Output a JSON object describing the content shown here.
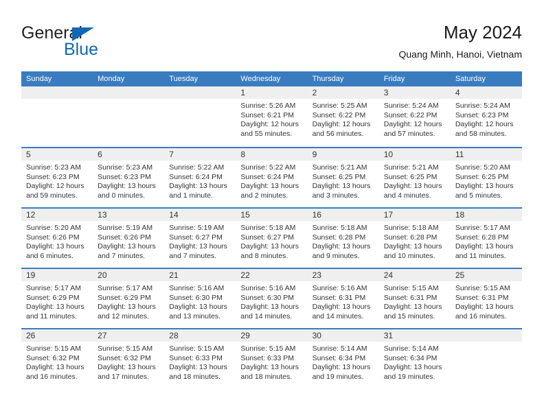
{
  "brand": {
    "name_top": "General",
    "name_bottom": "Blue",
    "accent_color": "#1268b3"
  },
  "header": {
    "title": "May 2024",
    "subtitle": "Quang Minh, Hanoi, Vietnam"
  },
  "theme": {
    "header_bar": "#3a7cc0",
    "day_band": "#efefef",
    "text": "#333333"
  },
  "weekdays": [
    "Sunday",
    "Monday",
    "Tuesday",
    "Wednesday",
    "Thursday",
    "Friday",
    "Saturday"
  ],
  "weeks": [
    [
      {
        "day": "",
        "lines": []
      },
      {
        "day": "",
        "lines": []
      },
      {
        "day": "",
        "lines": []
      },
      {
        "day": "1",
        "lines": [
          "Sunrise: 5:26 AM",
          "Sunset: 6:21 PM",
          "Daylight: 12 hours",
          "and 55 minutes."
        ]
      },
      {
        "day": "2",
        "lines": [
          "Sunrise: 5:25 AM",
          "Sunset: 6:22 PM",
          "Daylight: 12 hours",
          "and 56 minutes."
        ]
      },
      {
        "day": "3",
        "lines": [
          "Sunrise: 5:24 AM",
          "Sunset: 6:22 PM",
          "Daylight: 12 hours",
          "and 57 minutes."
        ]
      },
      {
        "day": "4",
        "lines": [
          "Sunrise: 5:24 AM",
          "Sunset: 6:23 PM",
          "Daylight: 12 hours",
          "and 58 minutes."
        ]
      }
    ],
    [
      {
        "day": "5",
        "lines": [
          "Sunrise: 5:23 AM",
          "Sunset: 6:23 PM",
          "Daylight: 12 hours",
          "and 59 minutes."
        ]
      },
      {
        "day": "6",
        "lines": [
          "Sunrise: 5:23 AM",
          "Sunset: 6:23 PM",
          "Daylight: 13 hours",
          "and 0 minutes."
        ]
      },
      {
        "day": "7",
        "lines": [
          "Sunrise: 5:22 AM",
          "Sunset: 6:24 PM",
          "Daylight: 13 hours",
          "and 1 minute."
        ]
      },
      {
        "day": "8",
        "lines": [
          "Sunrise: 5:22 AM",
          "Sunset: 6:24 PM",
          "Daylight: 13 hours",
          "and 2 minutes."
        ]
      },
      {
        "day": "9",
        "lines": [
          "Sunrise: 5:21 AM",
          "Sunset: 6:25 PM",
          "Daylight: 13 hours",
          "and 3 minutes."
        ]
      },
      {
        "day": "10",
        "lines": [
          "Sunrise: 5:21 AM",
          "Sunset: 6:25 PM",
          "Daylight: 13 hours",
          "and 4 minutes."
        ]
      },
      {
        "day": "11",
        "lines": [
          "Sunrise: 5:20 AM",
          "Sunset: 6:25 PM",
          "Daylight: 13 hours",
          "and 5 minutes."
        ]
      }
    ],
    [
      {
        "day": "12",
        "lines": [
          "Sunrise: 5:20 AM",
          "Sunset: 6:26 PM",
          "Daylight: 13 hours",
          "and 6 minutes."
        ]
      },
      {
        "day": "13",
        "lines": [
          "Sunrise: 5:19 AM",
          "Sunset: 6:26 PM",
          "Daylight: 13 hours",
          "and 7 minutes."
        ]
      },
      {
        "day": "14",
        "lines": [
          "Sunrise: 5:19 AM",
          "Sunset: 6:27 PM",
          "Daylight: 13 hours",
          "and 7 minutes."
        ]
      },
      {
        "day": "15",
        "lines": [
          "Sunrise: 5:18 AM",
          "Sunset: 6:27 PM",
          "Daylight: 13 hours",
          "and 8 minutes."
        ]
      },
      {
        "day": "16",
        "lines": [
          "Sunrise: 5:18 AM",
          "Sunset: 6:28 PM",
          "Daylight: 13 hours",
          "and 9 minutes."
        ]
      },
      {
        "day": "17",
        "lines": [
          "Sunrise: 5:18 AM",
          "Sunset: 6:28 PM",
          "Daylight: 13 hours",
          "and 10 minutes."
        ]
      },
      {
        "day": "18",
        "lines": [
          "Sunrise: 5:17 AM",
          "Sunset: 6:28 PM",
          "Daylight: 13 hours",
          "and 11 minutes."
        ]
      }
    ],
    [
      {
        "day": "19",
        "lines": [
          "Sunrise: 5:17 AM",
          "Sunset: 6:29 PM",
          "Daylight: 13 hours",
          "and 11 minutes."
        ]
      },
      {
        "day": "20",
        "lines": [
          "Sunrise: 5:17 AM",
          "Sunset: 6:29 PM",
          "Daylight: 13 hours",
          "and 12 minutes."
        ]
      },
      {
        "day": "21",
        "lines": [
          "Sunrise: 5:16 AM",
          "Sunset: 6:30 PM",
          "Daylight: 13 hours",
          "and 13 minutes."
        ]
      },
      {
        "day": "22",
        "lines": [
          "Sunrise: 5:16 AM",
          "Sunset: 6:30 PM",
          "Daylight: 13 hours",
          "and 14 minutes."
        ]
      },
      {
        "day": "23",
        "lines": [
          "Sunrise: 5:16 AM",
          "Sunset: 6:31 PM",
          "Daylight: 13 hours",
          "and 14 minutes."
        ]
      },
      {
        "day": "24",
        "lines": [
          "Sunrise: 5:15 AM",
          "Sunset: 6:31 PM",
          "Daylight: 13 hours",
          "and 15 minutes."
        ]
      },
      {
        "day": "25",
        "lines": [
          "Sunrise: 5:15 AM",
          "Sunset: 6:31 PM",
          "Daylight: 13 hours",
          "and 16 minutes."
        ]
      }
    ],
    [
      {
        "day": "26",
        "lines": [
          "Sunrise: 5:15 AM",
          "Sunset: 6:32 PM",
          "Daylight: 13 hours",
          "and 16 minutes."
        ]
      },
      {
        "day": "27",
        "lines": [
          "Sunrise: 5:15 AM",
          "Sunset: 6:32 PM",
          "Daylight: 13 hours",
          "and 17 minutes."
        ]
      },
      {
        "day": "28",
        "lines": [
          "Sunrise: 5:15 AM",
          "Sunset: 6:33 PM",
          "Daylight: 13 hours",
          "and 18 minutes."
        ]
      },
      {
        "day": "29",
        "lines": [
          "Sunrise: 5:15 AM",
          "Sunset: 6:33 PM",
          "Daylight: 13 hours",
          "and 18 minutes."
        ]
      },
      {
        "day": "30",
        "lines": [
          "Sunrise: 5:14 AM",
          "Sunset: 6:34 PM",
          "Daylight: 13 hours",
          "and 19 minutes."
        ]
      },
      {
        "day": "31",
        "lines": [
          "Sunrise: 5:14 AM",
          "Sunset: 6:34 PM",
          "Daylight: 13 hours",
          "and 19 minutes."
        ]
      },
      {
        "day": "",
        "lines": []
      }
    ]
  ]
}
